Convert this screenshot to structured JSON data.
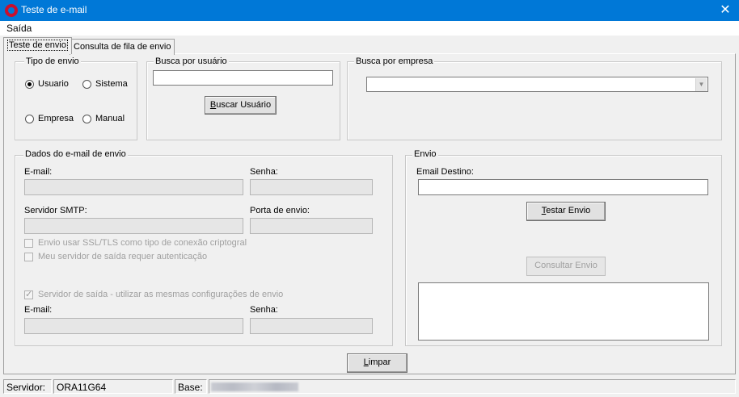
{
  "window": {
    "title": "Teste de e-mail",
    "close_glyph": "✕"
  },
  "menu": {
    "saida": "Saída"
  },
  "tabs": [
    {
      "label": "Teste de envio"
    },
    {
      "label": "Consulta de fila de envio"
    }
  ],
  "tipo_envio": {
    "legend": "Tipo de envio",
    "options": [
      {
        "label": "Usuario",
        "checked": true
      },
      {
        "label": "Sistema",
        "checked": false
      },
      {
        "label": "Empresa",
        "checked": false
      },
      {
        "label": "Manual",
        "checked": false
      }
    ]
  },
  "busca_usuario": {
    "legend": "Busca por usuário",
    "value": "",
    "button_prefix": "",
    "button_underline": "B",
    "button_rest": "uscar Usuário"
  },
  "busca_empresa": {
    "legend": "Busca por empresa",
    "value": ""
  },
  "dados": {
    "legend": "Dados do e-mail de envio",
    "email_label": "E-mail:",
    "senha_label": "Senha:",
    "smtp_label": "Servidor SMTP:",
    "porta_label": "Porta de envio:",
    "ssl_label": "Envio usar SSL/TLS como tipo de conexão criptogral",
    "auth_label": "Meu servidor de saída requer autenticação",
    "same_config_label": "Servidor de saída - utilizar as mesmas configurações de envio",
    "email2_label": "E-mail:",
    "senha2_label": "Senha:"
  },
  "envio": {
    "legend": "Envio",
    "email_destino_label": "Email Destino:",
    "email_destino_value": "",
    "testar_underline": "T",
    "testar_rest": "estar Envio",
    "consultar_label": "Consultar Envio"
  },
  "limpar": {
    "underline": "L",
    "rest": "impar"
  },
  "status": {
    "servidor_label": "Servidor:",
    "servidor_value": "ORA11G64",
    "base_label": "Base:"
  },
  "icons": {
    "app": "app-logo-icon",
    "close": "close-icon",
    "dropdown": "chevron-down-icon"
  },
  "colors": {
    "titlebar": "#0078d7",
    "logo": "#c8102e"
  }
}
